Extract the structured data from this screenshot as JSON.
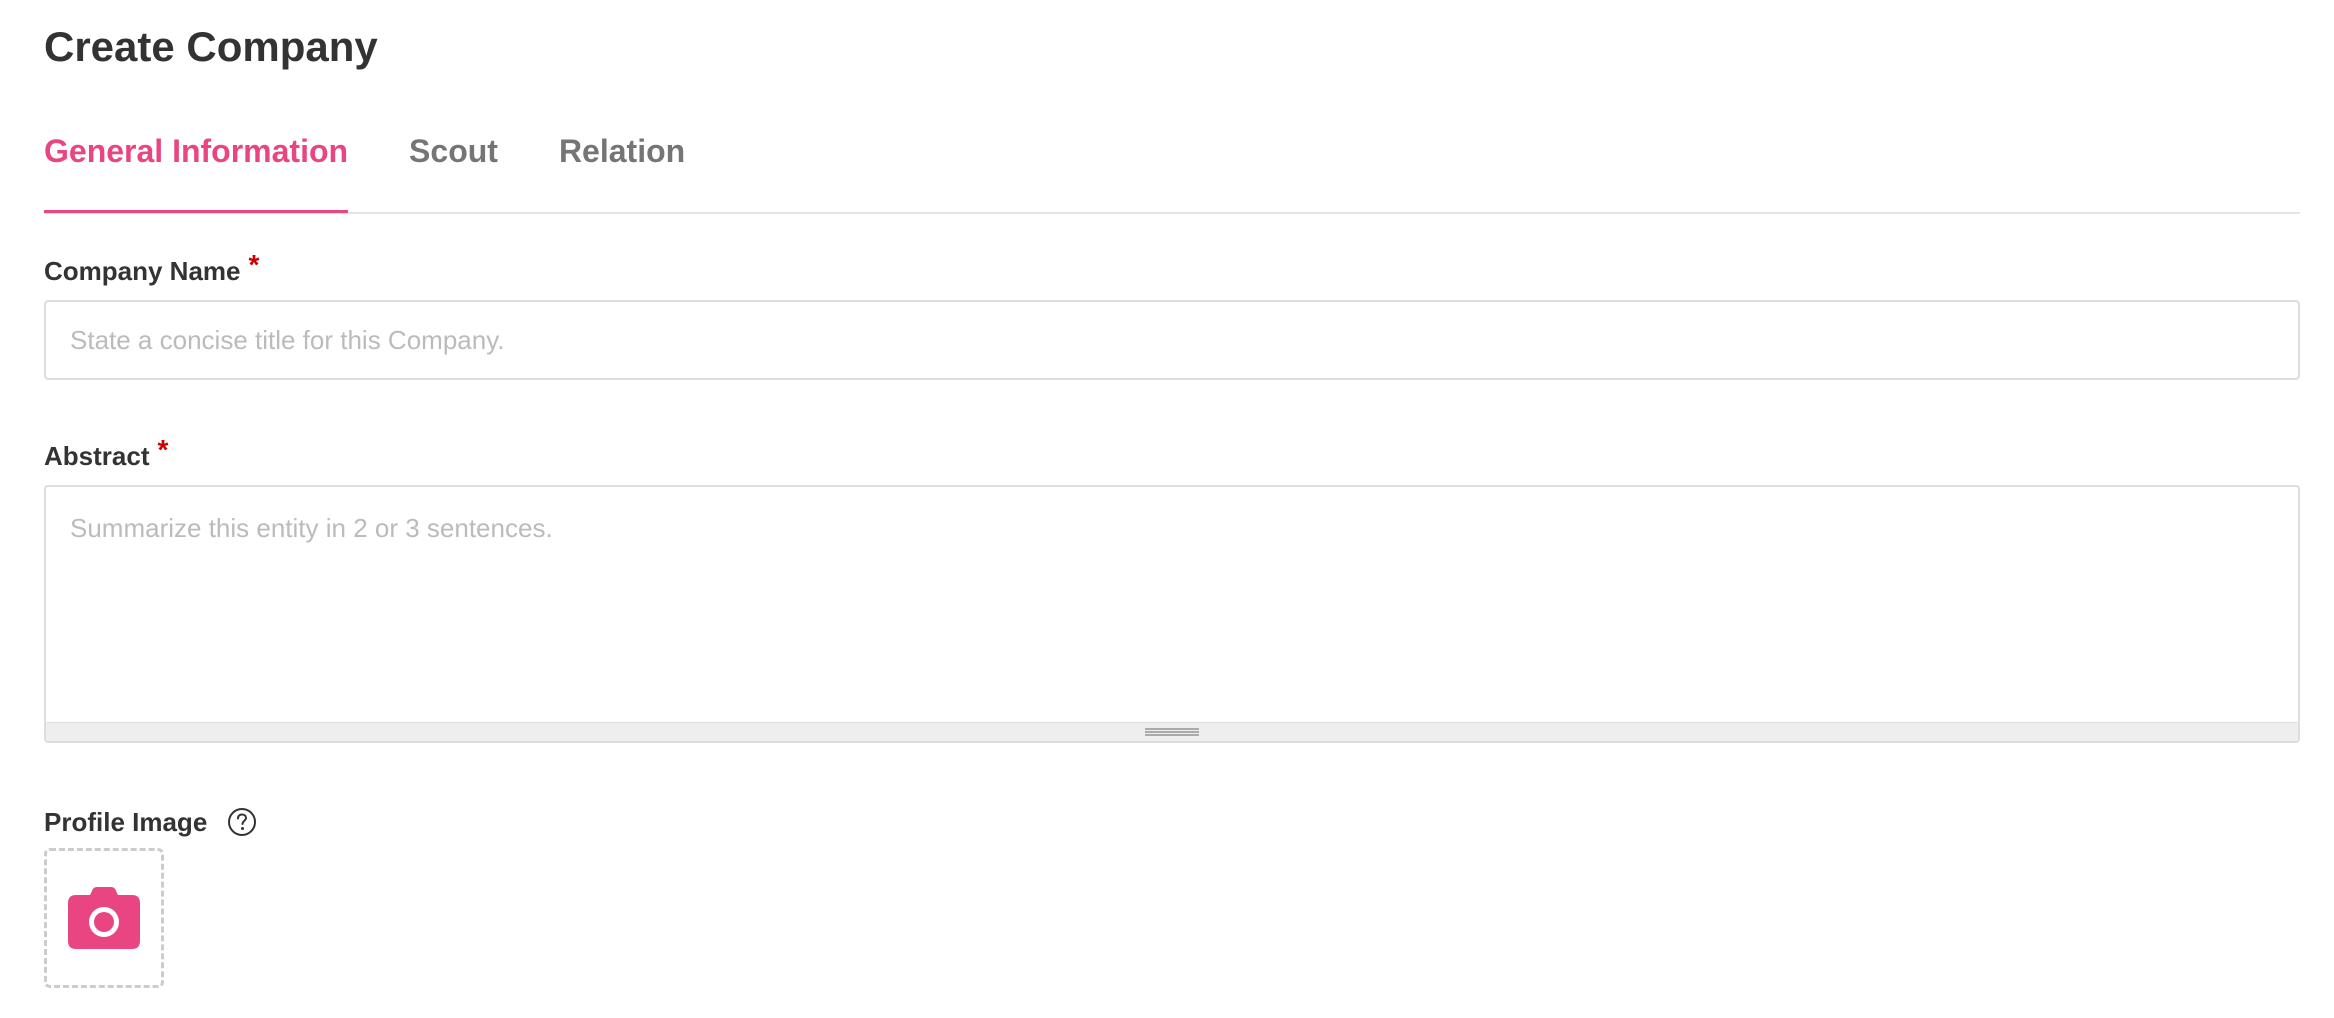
{
  "page": {
    "title": "Create Company"
  },
  "tabs": [
    {
      "label": "General Information",
      "active": true
    },
    {
      "label": "Scout",
      "active": false
    },
    {
      "label": "Relation",
      "active": false
    }
  ],
  "form": {
    "company_name": {
      "label": "Company Name",
      "required_mark": "*",
      "value": "",
      "placeholder": "State a concise title for this Company."
    },
    "abstract": {
      "label": "Abstract",
      "required_mark": "*",
      "value": "",
      "placeholder": "Summarize this entity in 2 or 3 sentences."
    },
    "profile_image": {
      "label": "Profile Image",
      "help_icon": "question-circle-icon",
      "upload_icon": "camera-icon"
    }
  },
  "colors": {
    "accent": "#e94583",
    "required": "#cc0000",
    "tab_inactive": "#757575",
    "text": "#333333",
    "placeholder": "#bbbbbb",
    "border": "#dddddd"
  }
}
